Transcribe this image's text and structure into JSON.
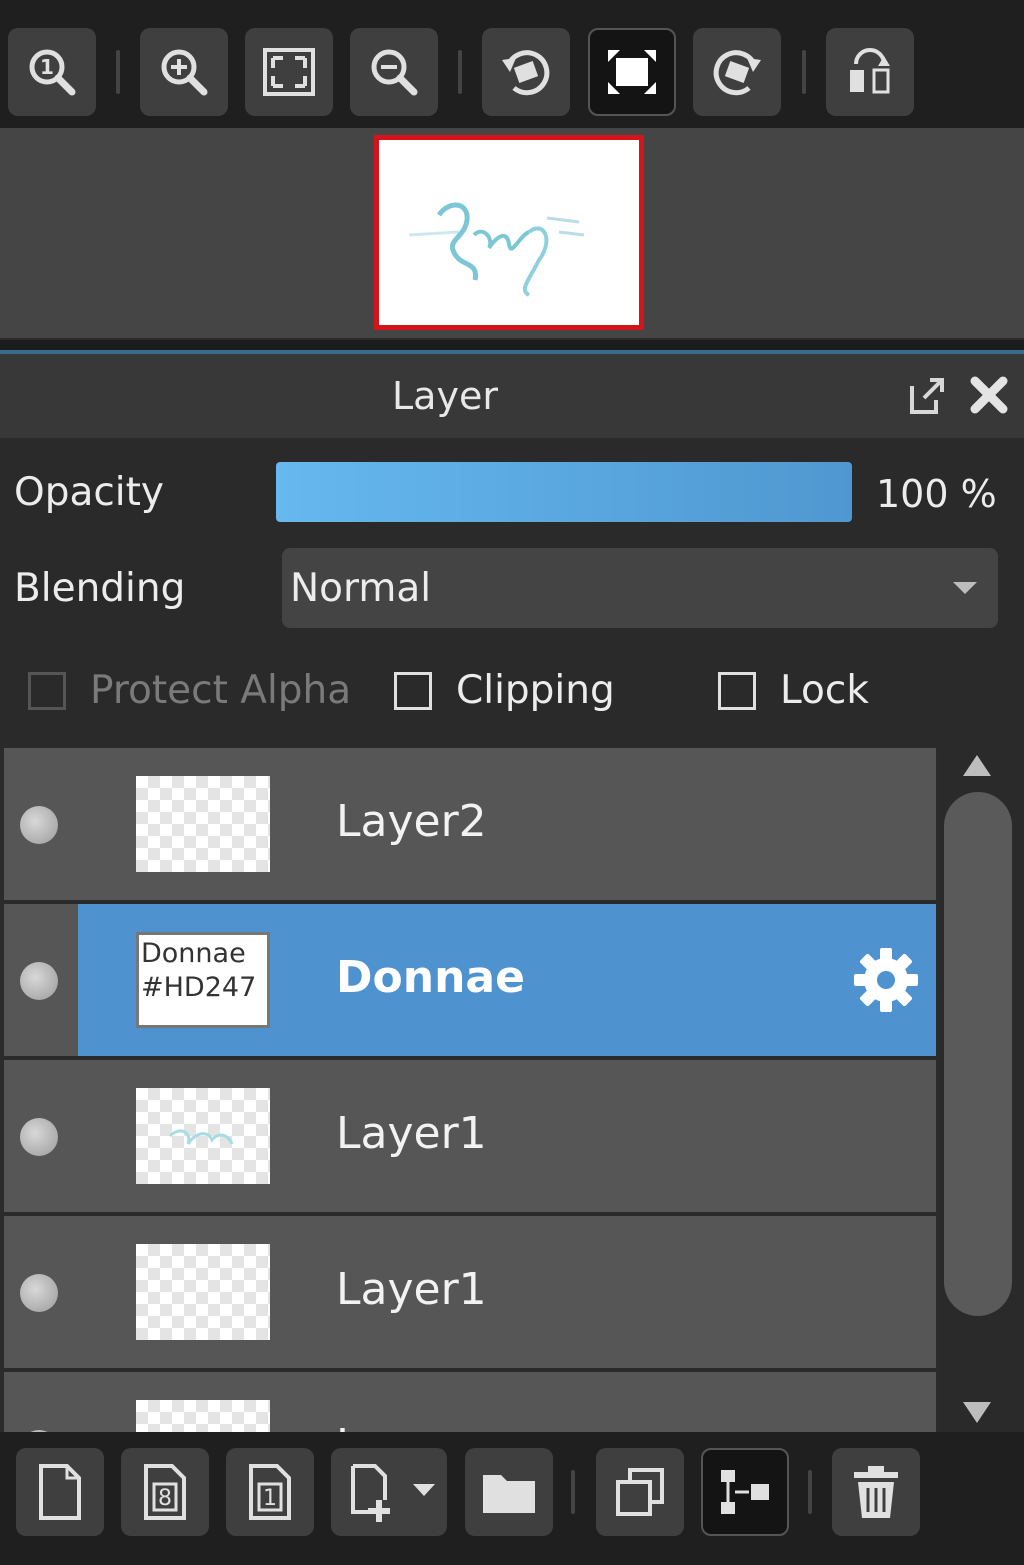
{
  "top_toolbar": {
    "buttons": [
      {
        "icon": "zoom-actual-size-icon",
        "label": "1"
      },
      {
        "icon": "zoom-in-icon"
      },
      {
        "icon": "fit-to-screen-icon"
      },
      {
        "icon": "zoom-out-icon"
      },
      {
        "icon": "rotate-left-icon"
      },
      {
        "icon": "fullscreen-icon"
      },
      {
        "icon": "rotate-right-icon"
      },
      {
        "icon": "flip-horizontal-icon"
      }
    ]
  },
  "navigator": {
    "thumbnail_border_color": "#d4141a"
  },
  "panel": {
    "title": "Layer",
    "popout_icon": "popout-icon",
    "close_icon": "close-icon"
  },
  "opacity": {
    "label": "Opacity",
    "value": 100,
    "value_text": "100 %"
  },
  "blending": {
    "label": "Blending",
    "selected": "Normal"
  },
  "checkboxes": {
    "protect_alpha": {
      "label": "Protect Alpha",
      "checked": false,
      "enabled": false
    },
    "clipping": {
      "label": "Clipping",
      "checked": false,
      "enabled": true
    },
    "lock": {
      "label": "Lock",
      "checked": false,
      "enabled": true
    }
  },
  "layers": [
    {
      "name": "Layer2",
      "selected": false,
      "thumb_text": ""
    },
    {
      "name": "Donnae",
      "selected": true,
      "thumb_text_line1": "Donnae",
      "thumb_text_line2": "#HD247"
    },
    {
      "name": "Layer1",
      "selected": false,
      "thumb_text": ""
    },
    {
      "name": "Layer1",
      "selected": false,
      "thumb_text": ""
    },
    {
      "name": "Layer",
      "selected": false,
      "thumb_text": ""
    }
  ],
  "bottom_toolbar": {
    "buttons": [
      {
        "icon": "new-layer-icon"
      },
      {
        "icon": "new-8bit-layer-icon",
        "label": "8"
      },
      {
        "icon": "new-1bit-layer-icon",
        "label": "1"
      },
      {
        "icon": "add-layer-dropdown-icon"
      },
      {
        "icon": "folder-icon"
      },
      {
        "icon": "duplicate-layer-icon"
      },
      {
        "icon": "merge-layer-icon"
      },
      {
        "icon": "delete-layer-icon"
      }
    ]
  },
  "colors": {
    "accent": "#4e92cf",
    "panel_bg": "#2a2a2a",
    "row_bg": "#565656"
  }
}
